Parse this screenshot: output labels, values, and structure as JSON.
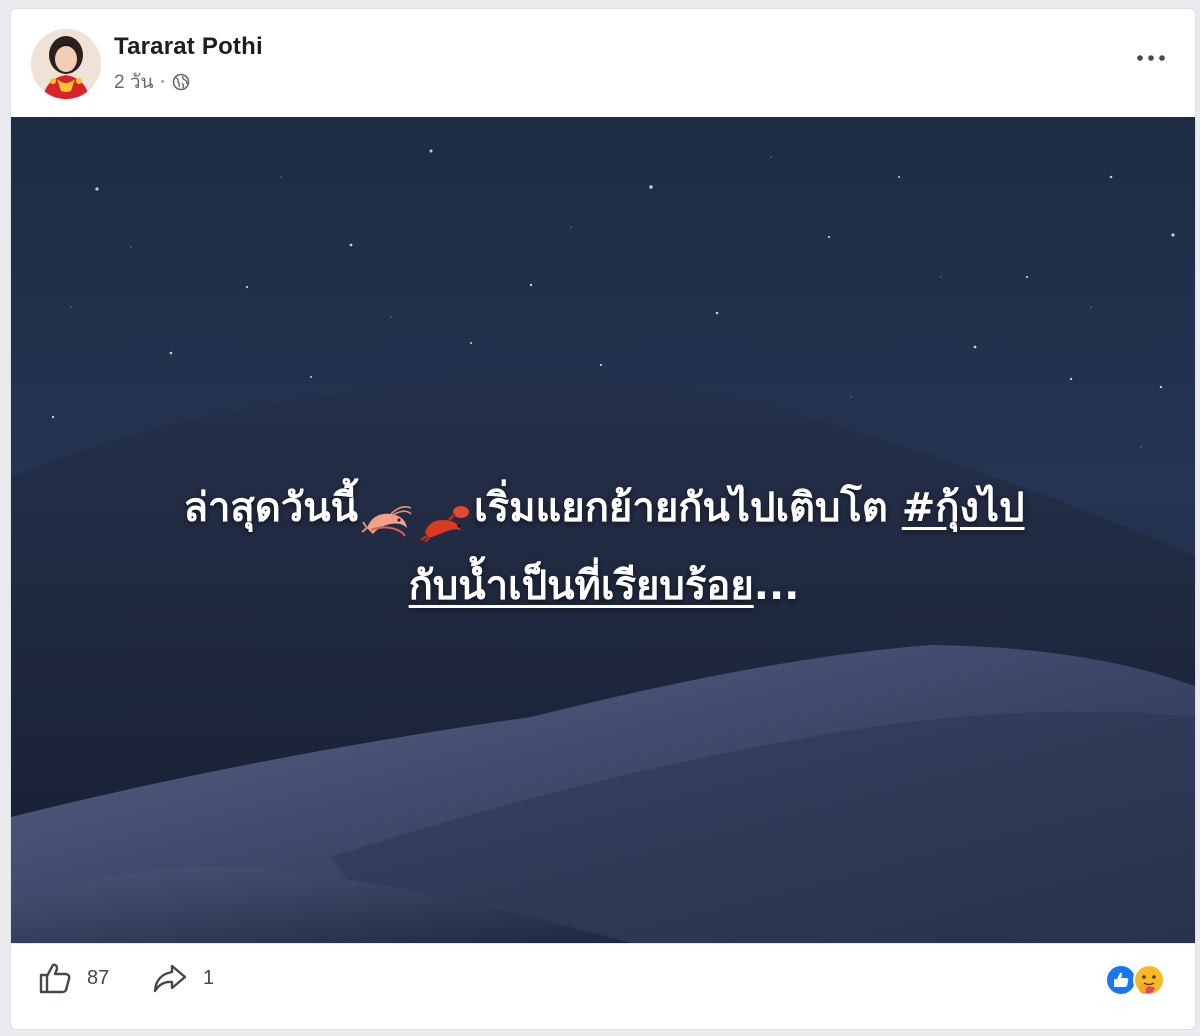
{
  "post": {
    "author": "Tararat Pothi",
    "time": "2 วัน",
    "separator": "·",
    "privacy_icon": "globe-icon",
    "more_icon": "more-options-icon",
    "caption": {
      "line1_start": "ล่าสุดวันนี้",
      "emoji_1": "shrimp-emoji",
      "emoji_2": "lobster-emoji",
      "line1_middle": "เริ่มแยกย้ายกันไปเติบโต ",
      "hashtag_part1": "#กุ้งไป",
      "hashtag_part2": "กับน้ำเป็นที่เรียบร้อย",
      "ellipsis": "..."
    },
    "photo": "night-sky-sand-dunes"
  },
  "footer": {
    "like_icon": "thumbs-up-icon",
    "like_count": "87",
    "share_icon": "share-arrow-icon",
    "share_count": "1",
    "reaction_icons": [
      "like-reaction-icon",
      "care-reaction-icon"
    ]
  },
  "colors": {
    "page_bg": "#e9ebee",
    "card_bg": "#ffffff",
    "text_primary": "#1c1e21",
    "text_secondary": "#65676b",
    "like_blue": "#1877f2",
    "care_yellow": "#f7b928",
    "sky_top": "#1d2b44",
    "dune_mid": "#2f3d5c"
  }
}
